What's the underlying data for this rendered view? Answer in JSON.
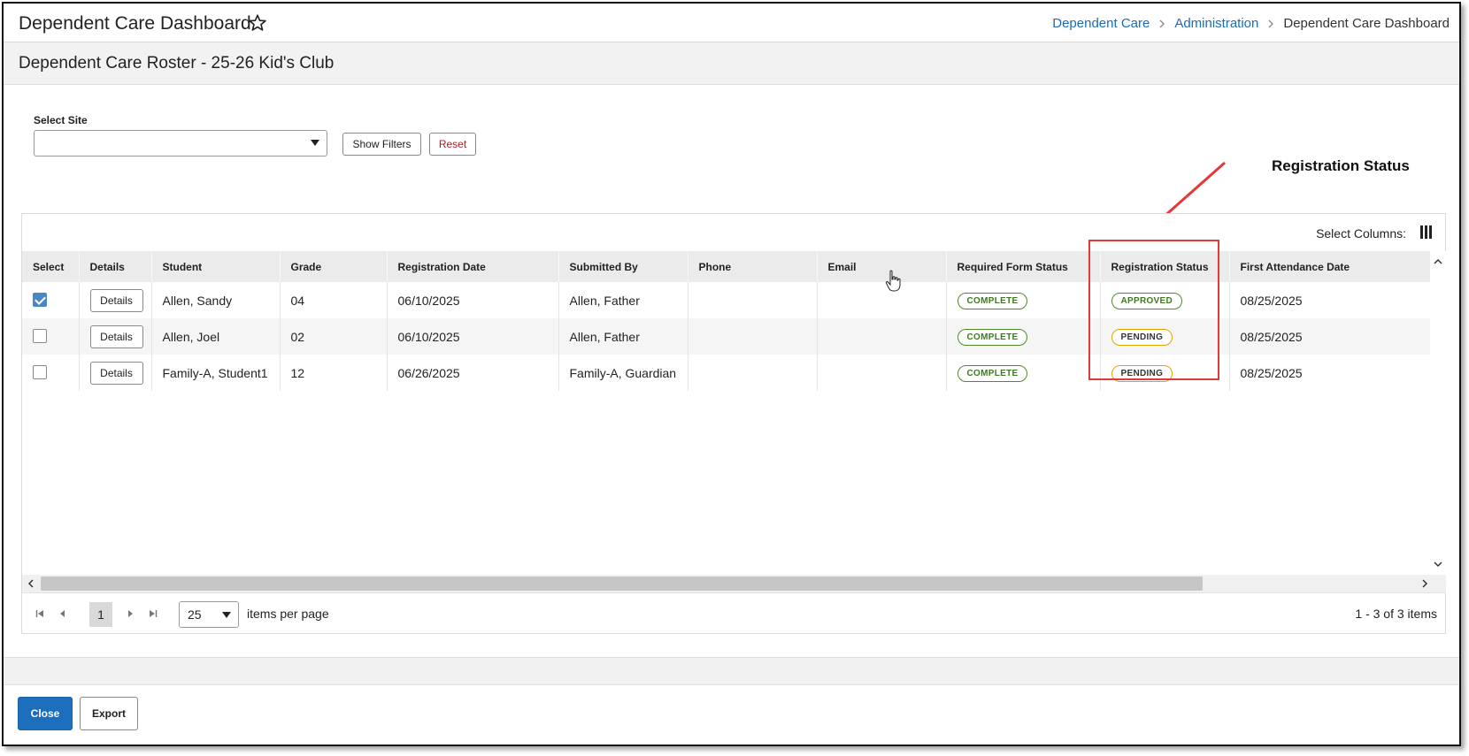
{
  "header": {
    "title": "Dependent Care Dashboard",
    "breadcrumb": {
      "items": [
        "Dependent Care",
        "Administration"
      ],
      "current": "Dependent Care Dashboard"
    }
  },
  "roster": {
    "title": "Dependent Care Roster - 25-26 Kid's Club"
  },
  "filters": {
    "site_label": "Select Site",
    "site_value": "",
    "show_filters_label": "Show Filters",
    "reset_label": "Reset"
  },
  "annotation": {
    "label": "Registration Status",
    "color": "#e2393a"
  },
  "grid": {
    "select_columns_label": "Select Columns:",
    "columns": [
      "Select",
      "Details",
      "Student",
      "Grade",
      "Registration Date",
      "Submitted By",
      "Phone",
      "Email",
      "Required Form Status",
      "Registration Status",
      "First Attendance Date"
    ],
    "details_label": "Details",
    "rows": [
      {
        "selected": true,
        "student": "Allen, Sandy",
        "grade": "04",
        "registration_date": "06/10/2025",
        "submitted_by": "Allen, Father",
        "phone": "",
        "email": "",
        "form_status": "COMPLETE",
        "registration_status": "APPROVED",
        "first_attendance": "08/25/2025"
      },
      {
        "selected": false,
        "student": "Allen, Joel",
        "grade": "02",
        "registration_date": "06/10/2025",
        "submitted_by": "Allen, Father",
        "phone": "",
        "email": "",
        "form_status": "COMPLETE",
        "registration_status": "PENDING",
        "first_attendance": "08/25/2025"
      },
      {
        "selected": false,
        "student": "Family-A, Student1",
        "grade": "12",
        "registration_date": "06/26/2025",
        "submitted_by": "Family-A, Guardian",
        "phone": "",
        "email": "",
        "form_status": "COMPLETE",
        "registration_status": "PENDING",
        "first_attendance": "08/25/2025"
      }
    ]
  },
  "pager": {
    "current_page": "1",
    "per_page": "25",
    "items_per_page_label": "items per page",
    "range_text": "1 - 3 of 3 items"
  },
  "footer": {
    "close_label": "Close",
    "export_label": "Export"
  },
  "colors": {
    "link": "#1b6bb8",
    "primary_button": "#1d6fbd",
    "approved": "#4f8a2b",
    "pending": "#e0a300",
    "reset_text": "#c0141b"
  }
}
